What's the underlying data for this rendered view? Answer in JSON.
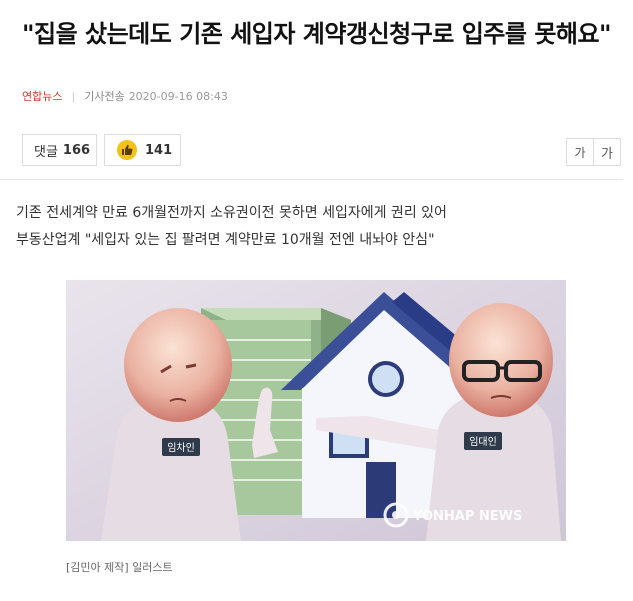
{
  "article": {
    "headline": "\"집을 샀는데도 기존 세입자 계약갱신청구로 입주를 못해요\"",
    "press": "연합뉴스",
    "type": "기사전송",
    "datetime": "2020-09-16 08:43"
  },
  "toolbar": {
    "comment_label": "댓글",
    "comment_count": "166",
    "like_icon": "thumbs-up-icon",
    "like_count": "141",
    "font_small": "가",
    "font_large": "가"
  },
  "summary": {
    "line1": "기존 전세계약 만료 6개월전까지 소유권이전 못하면 세입자에게 권리 있어",
    "line2": "부동산업계 \"세입자 있는 집 팔려면 계약만료 10개월 전엔 내놔야 안심\""
  },
  "figure": {
    "tenant_tag": "임차인",
    "landlord_tag": "임대인",
    "watermark": "YONHAP NEWS",
    "caption": "[김민아 제작] 일러스트"
  },
  "colors": {
    "press": "#c0392b",
    "like": "#f2c21a"
  }
}
